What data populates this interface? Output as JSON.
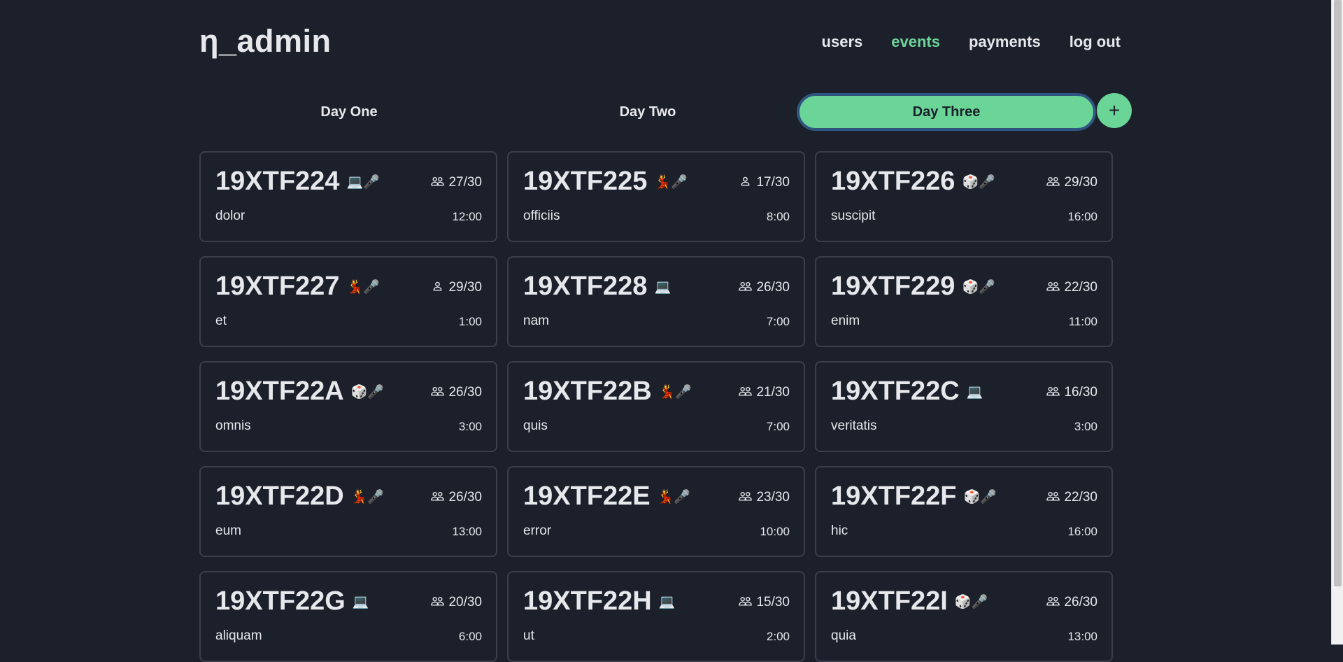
{
  "brand": "η_admin",
  "nav": [
    "users",
    "events",
    "payments",
    "log out"
  ],
  "nav_active": "events",
  "tabs": [
    "Day One",
    "Day Two",
    "Day Three"
  ],
  "active_tab": "Day Three",
  "add_tab_label": "+",
  "events": [
    {
      "code": "19XTF224",
      "tags": "💻🎤",
      "group": "group",
      "capacity": "27/30",
      "name": "dolor",
      "time": "12:00"
    },
    {
      "code": "19XTF225",
      "tags": "💃🎤",
      "group": "single",
      "capacity": "17/30",
      "name": "officiis",
      "time": "8:00"
    },
    {
      "code": "19XTF226",
      "tags": "🎲🎤",
      "group": "group",
      "capacity": "29/30",
      "name": "suscipit",
      "time": "16:00"
    },
    {
      "code": "19XTF227",
      "tags": "💃🎤",
      "group": "single",
      "capacity": "29/30",
      "name": "et",
      "time": "1:00"
    },
    {
      "code": "19XTF228",
      "tags": "💻",
      "group": "group",
      "capacity": "26/30",
      "name": "nam",
      "time": "7:00"
    },
    {
      "code": "19XTF229",
      "tags": "🎲🎤",
      "group": "group",
      "capacity": "22/30",
      "name": "enim",
      "time": "11:00"
    },
    {
      "code": "19XTF22A",
      "tags": "🎲🎤",
      "group": "group",
      "capacity": "26/30",
      "name": "omnis",
      "time": "3:00"
    },
    {
      "code": "19XTF22B",
      "tags": "💃🎤",
      "group": "group",
      "capacity": "21/30",
      "name": "quis",
      "time": "7:00"
    },
    {
      "code": "19XTF22C",
      "tags": "💻",
      "group": "group",
      "capacity": "16/30",
      "name": "veritatis",
      "time": "3:00"
    },
    {
      "code": "19XTF22D",
      "tags": "💃🎤",
      "group": "group",
      "capacity": "26/30",
      "name": "eum",
      "time": "13:00"
    },
    {
      "code": "19XTF22E",
      "tags": "💃🎤",
      "group": "group",
      "capacity": "23/30",
      "name": "error",
      "time": "10:00"
    },
    {
      "code": "19XTF22F",
      "tags": "🎲🎤",
      "group": "group",
      "capacity": "22/30",
      "name": "hic",
      "time": "16:00"
    },
    {
      "code": "19XTF22G",
      "tags": "💻",
      "group": "group",
      "capacity": "20/30",
      "name": "aliquam",
      "time": "6:00"
    },
    {
      "code": "19XTF22H",
      "tags": "💻",
      "group": "group",
      "capacity": "15/30",
      "name": "ut",
      "time": "2:00"
    },
    {
      "code": "19XTF22I",
      "tags": "🎲🎤",
      "group": "group",
      "capacity": "26/30",
      "name": "quia",
      "time": "13:00"
    }
  ],
  "colors": {
    "background": "#1c202b",
    "accent": "#6ad597",
    "card_border": "#3a3f4b",
    "text": "#e6e8ec"
  }
}
